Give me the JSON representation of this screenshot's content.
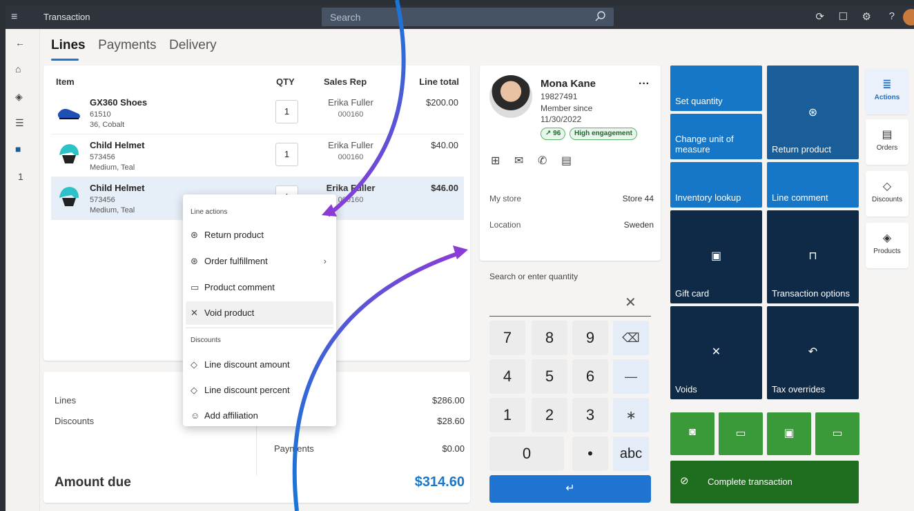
{
  "topbar": {
    "title": "Transaction",
    "search_placeholder": "Search"
  },
  "rail": {
    "badge_count": "1"
  },
  "tabs": [
    "Lines",
    "Payments",
    "Delivery"
  ],
  "lines": {
    "headers": {
      "item": "Item",
      "qty": "QTY",
      "sales_rep": "Sales Rep",
      "line_total": "Line total"
    },
    "rows": [
      {
        "name": "GX360 Shoes",
        "sku": "61510",
        "variant": "36, Cobalt",
        "qty": "1",
        "rep": "Erika Fuller",
        "rep_id": "000160",
        "total": "$200.00"
      },
      {
        "name": "Child Helmet",
        "sku": "573456",
        "variant": "Medium, Teal",
        "qty": "1",
        "rep": "Erika Fuller",
        "rep_id": "000160",
        "total": "$40.00"
      },
      {
        "name": "Child Helmet",
        "sku": "573456",
        "variant": "Medium, Teal",
        "qty": "1",
        "rep": "Erika Fuller",
        "rep_id": "000160",
        "total": "$46.00"
      }
    ]
  },
  "totals": {
    "lines_label": "Lines",
    "lines_value": "$286.00",
    "discounts_label": "Discounts",
    "discounts_value": "$28.60",
    "payments_label": "Payments",
    "payments_value": "$0.00",
    "due_label": "Amount due",
    "due_value": "$314.60"
  },
  "menu": {
    "section1": "Line actions",
    "items1": [
      "Return product",
      "Order fulfillment",
      "Product comment",
      "Void product"
    ],
    "section2": "Discounts",
    "items2": [
      "Line discount amount",
      "Line discount percent",
      "Add affiliation"
    ]
  },
  "customer": {
    "name": "Mona Kane",
    "id": "19827491",
    "member_since_label": "Member since",
    "member_since": "11/30/2022",
    "score": "96",
    "engagement": "High engagement",
    "store_label": "My store",
    "store_value": "Store 44",
    "location_label": "Location",
    "location_value": "Sweden"
  },
  "numpad": {
    "label": "Search or enter quantity",
    "keys": [
      "7",
      "8",
      "9",
      "4",
      "5",
      "6",
      "1",
      "2",
      "3",
      "0",
      "•",
      "abc"
    ],
    "ops": [
      "—",
      "∗"
    ]
  },
  "tiles": {
    "set_quantity": "Set quantity",
    "return_product": "Return product",
    "change_unit": "Change unit of measure",
    "inventory_lookup": "Inventory lookup",
    "line_comment": "Line comment",
    "gift_card": "Gift card",
    "transaction_options": "Transaction options",
    "voids": "Voids",
    "tax_overrides": "Tax overrides",
    "complete": "Complete transaction"
  },
  "side": {
    "actions": "Actions",
    "orders": "Orders",
    "discounts": "Discounts",
    "products": "Products"
  },
  "colors": {
    "accent": "#1976c9",
    "tile_blue": "#1677c8",
    "tile_navy": "#0f2a46",
    "tile_green": "#3a9a3a",
    "tile_dark_green": "#1f6e1f"
  }
}
